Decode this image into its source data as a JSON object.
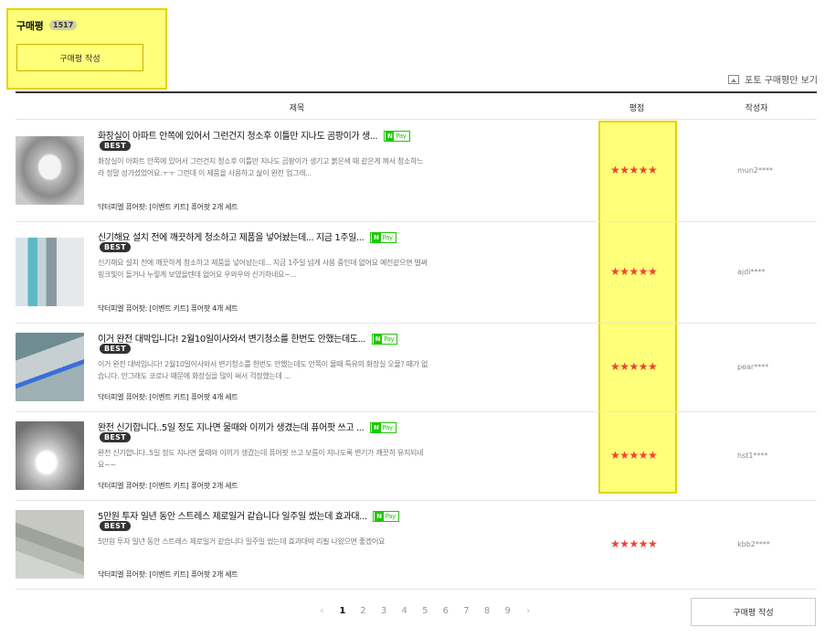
{
  "header": {
    "title": "구매평",
    "count": "1517",
    "write_button": "구매평 작성",
    "photo_only": "포토 구매평만 보기"
  },
  "columns": {
    "title": "제목",
    "rating": "평점",
    "author": "작성자"
  },
  "best_label": "BEST",
  "npay": {
    "n": "N",
    "pay": "Pay"
  },
  "colors": {
    "highlight": "#ffff7a",
    "star": "#f14236",
    "npay": "#1ec800"
  },
  "reviews": [
    {
      "title": "화장실이 아파트 안쪽에 있어서 그런건지 청소후 이틀만 지나도 곰팡이가 생...",
      "body": "화장실이 아파트 안쪽에 있어서 그런건지 청소후 이틀만 지나도 곰팡이가 생기고 붉은색 때 같은게 껴서 청소하느라 정말 성가셨었어요.ㅜㅜ 그런데 이 제품을 사용하고 삶이 완전 업그레...",
      "option": "닥터피엘 퓨어팟: [이벤트 키트] 퓨어팟 2개 세트",
      "stars": "★★★★★",
      "rating": 5,
      "author": "mun2****"
    },
    {
      "title": "신기해요 설치 전에 깨끗하게 청소하고 제품을 넣어놨는데... 지금 1주일...",
      "body": "신기해요 설치 전에 깨끗하게 청소하고 제품을 넣어놨는데... 지금 1주일 넘게 사용 중인데 없어요 예전같으면 벌써 핑크빛이 돌거나 누렇게 보였을텐데 없어요 우와우와 신기하네요~...",
      "option": "닥터피엘 퓨어팟: [이벤트 키트] 퓨어팟 4개 세트",
      "stars": "★★★★★",
      "rating": 5,
      "author": "ajdi****"
    },
    {
      "title": "이거 완전 대박입니다! 2월10일이사와서 변기청소를 한번도 안했는데도...",
      "body": "이거 완전 대박입니다! 2월10일이사와서 변기청소를 한번도 안했는데도 안쪽이 물때 특유의 화장실 오물? 때가 없습니다. 안그래도 코로나 때문에 화장실을 많이 써서 걱정했는데 ...",
      "option": "닥터피엘 퓨어팟: [이벤트 키트] 퓨어팟 4개 세트",
      "stars": "★★★★★",
      "rating": 5,
      "author": "pear****"
    },
    {
      "title": "완전 신기합니다..5일 정도 지나면 물때와 이끼가 생겼는데 퓨어팟 쓰고 ...",
      "body": "완전 신기합니다..5일 정도 지나면 물때와 이끼가 생겼는데 퓨어팟 쓰고 보름이 지나도록 변기가 깨끗히 유지되네요~~",
      "option": "닥터피엘 퓨어팟: [이벤트 키트] 퓨어팟 2개 세트",
      "stars": "★★★★★",
      "rating": 5,
      "author": "hst1****"
    },
    {
      "title": "5만원 투자 일년 동안 스트레스 제로일거 같습니다 일주일 썼는데 효과대...",
      "body": "5만원 투자 일년 동안 스트레스 제로일거 같습니다 일주일 썼는데 효과대박 리필 나왔으면 좋겠어요",
      "option": "닥터피엘 퓨어팟: [이벤트 키트] 퓨어팟 2개 세트",
      "stars": "★★★★★",
      "rating": 5,
      "author": "kbb2****"
    }
  ],
  "pagination": {
    "prev": "‹",
    "pages": [
      "1",
      "2",
      "3",
      "4",
      "5",
      "6",
      "7",
      "8",
      "9"
    ],
    "current": "1",
    "next": "›"
  },
  "bottom_write_button": "구매평 작성"
}
